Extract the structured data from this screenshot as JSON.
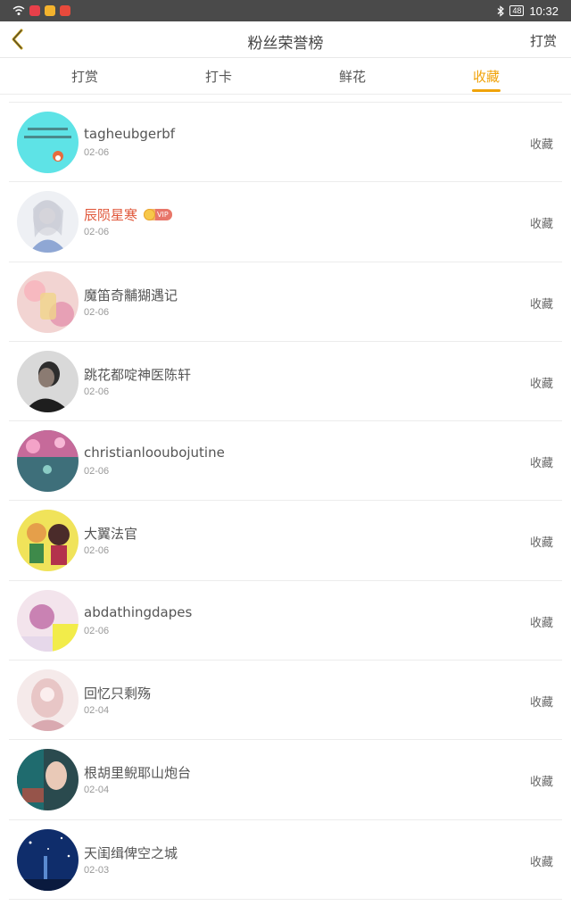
{
  "statusbar": {
    "time": "10:32",
    "battery": "48"
  },
  "header": {
    "title": "粉丝荣誉榜",
    "right_action": "打赏"
  },
  "tabs": [
    {
      "label": "打赏",
      "active": false
    },
    {
      "label": "打卡",
      "active": false
    },
    {
      "label": "鲜花",
      "active": false
    },
    {
      "label": "收藏",
      "active": true
    }
  ],
  "colors": {
    "accent": "#f0a30a",
    "vip_name": "#e0583b"
  },
  "badge": {
    "vip_label": "VIP"
  },
  "list": [
    {
      "name": "tagheubgerbf",
      "date": "02-06",
      "action": "收藏",
      "vip": false
    },
    {
      "name": "辰陨星寒",
      "date": "02-06",
      "action": "收藏",
      "vip": true
    },
    {
      "name": "魔笛奇黼猢遇记",
      "date": "02-06",
      "action": "收藏",
      "vip": false
    },
    {
      "name": "跳花都啶神医陈轩",
      "date": "02-06",
      "action": "收藏",
      "vip": false
    },
    {
      "name": "christianlooubojutine",
      "date": "02-06",
      "action": "收藏",
      "vip": false
    },
    {
      "name": "大翼法官",
      "date": "02-06",
      "action": "收藏",
      "vip": false
    },
    {
      "name": "abdathingdapes",
      "date": "02-06",
      "action": "收藏",
      "vip": false
    },
    {
      "name": "回忆只剩殇",
      "date": "02-04",
      "action": "收藏",
      "vip": false
    },
    {
      "name": "根胡里鲵耶山炮台",
      "date": "02-04",
      "action": "收藏",
      "vip": false
    },
    {
      "name": "天闺缉俾空之城",
      "date": "02-03",
      "action": "收藏",
      "vip": false
    }
  ]
}
